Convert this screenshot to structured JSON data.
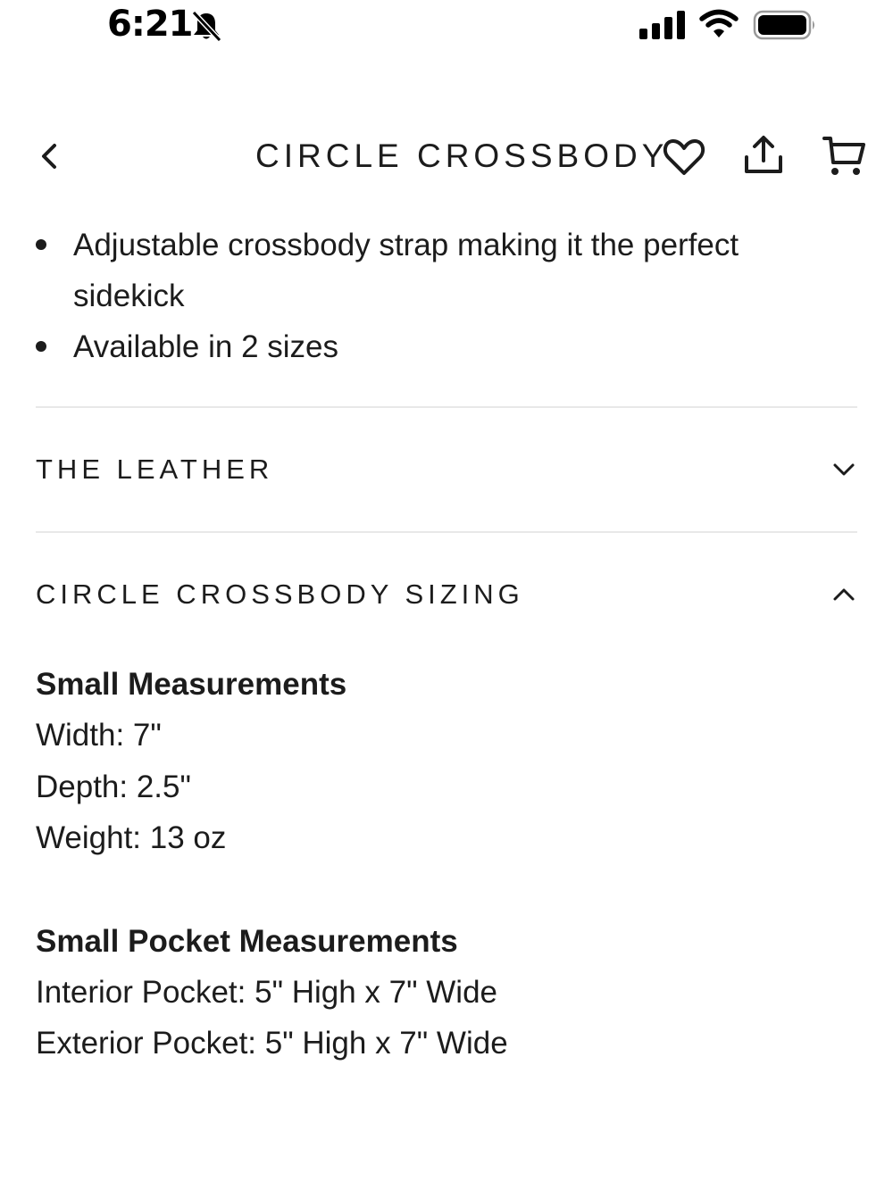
{
  "status_bar": {
    "time": "6:21",
    "icons": [
      "bell-slash-icon",
      "cellular-signal-icon",
      "wifi-icon",
      "battery-icon"
    ]
  },
  "header": {
    "title": "CIRCLE CROSSBODY",
    "icons": [
      "chevron-left-icon",
      "heart-icon",
      "share-icon",
      "cart-icon"
    ]
  },
  "features": [
    "Adjustable crossbody strap making it the perfect sidekick",
    "Available in 2 sizes"
  ],
  "accordions": [
    {
      "title": "THE LEATHER",
      "expanded": false,
      "icon": "chevron-down-icon"
    },
    {
      "title": "CIRCLE CROSSBODY SIZING",
      "expanded": true,
      "icon": "chevron-up-icon"
    }
  ],
  "sizing": {
    "small": {
      "heading": "Small Measurements",
      "width": "Width: 7\"",
      "depth": "Depth: 2.5\"",
      "weight": "Weight: 13 oz"
    },
    "small_pocket": {
      "heading": "Small Pocket Measurements",
      "interior": "Interior Pocket: 5\" High x 7\" Wide",
      "exterior": "Exterior Pocket: 5\" High x 7\" Wide"
    }
  },
  "colors": {
    "text": "#1c1c1c",
    "divider": "#e8e8e8",
    "background": "#ffffff"
  }
}
